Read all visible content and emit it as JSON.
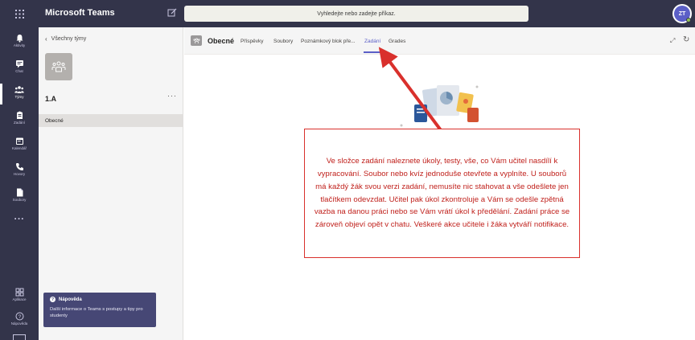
{
  "topbar": {
    "app_title": "Microsoft Teams",
    "search_placeholder": "Vyhledejte nebo zadejte příkaz.",
    "avatar_initials": "ZT"
  },
  "rail": {
    "items": [
      {
        "label": "Aktivity",
        "icon": "bell-icon"
      },
      {
        "label": "Chat",
        "icon": "chat-icon"
      },
      {
        "label": "Týmy",
        "icon": "teams-icon"
      },
      {
        "label": "Zadání",
        "icon": "assignments-icon"
      },
      {
        "label": "Kalendář",
        "icon": "calendar-icon"
      },
      {
        "label": "Hovory",
        "icon": "phone-icon"
      },
      {
        "label": "Soubory",
        "icon": "files-icon"
      }
    ],
    "active_index": 2,
    "more_label": "...",
    "bottom_items": [
      {
        "label": "Aplikace",
        "icon": "apps-icon"
      },
      {
        "label": "Nápověda",
        "icon": "help-icon"
      }
    ]
  },
  "panel": {
    "back_label": "Všechny týmy",
    "team_name": "1.A",
    "team_more": "···",
    "channel": "Obecné"
  },
  "help_popup": {
    "title": "Nápověda",
    "body": "Další informace o Teams s postupy a tipy pro studenty"
  },
  "main": {
    "channel_title": "Obecné",
    "tabs": [
      {
        "label": "Příspěvky",
        "active": false
      },
      {
        "label": "Soubory",
        "active": false
      },
      {
        "label": "Poznámkový blok pře...",
        "active": false
      },
      {
        "label": "Zadání",
        "active": true
      },
      {
        "label": "Grades",
        "active": false
      }
    ]
  },
  "annotation": {
    "text": "Ve složce zadání naleznete úkoly, testy, vše, co Vám učitel nasdílí k vypracování. Soubor nebo kvíz jednoduše otevřete a vyplníte. U souborů má každý žák svou verzi zadání, nemusíte nic stahovat a vše odešlete jen tlačítkem odevzdat. Učitel pak úkol zkontroluje a Vám se odešle zpětná vazba na danou práci nebo se Vám vrátí úkol k předělání. Zadání práce se zároveň objeví opět v chatu. Veškeré akce učitele i žáka vytváří notifikace.",
    "color": "#d9302c"
  },
  "colors": {
    "rail_bg": "#33344a",
    "accent": "#5b5fc7",
    "panel_bg": "#f5f5f5",
    "help_bg": "#464775"
  }
}
